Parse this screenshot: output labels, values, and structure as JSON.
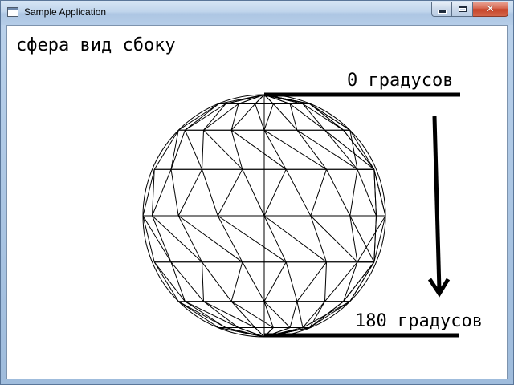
{
  "window": {
    "title": "Sample Application",
    "controls": {
      "minimize": "minimize-icon",
      "maximize": "maximize-icon",
      "close": "close-icon"
    }
  },
  "canvas": {
    "caption": "сфера вид сбоку",
    "label_top": "0 градусов",
    "label_bottom": "180 градусов",
    "line_color": "#000000",
    "background": "#ffffff"
  }
}
